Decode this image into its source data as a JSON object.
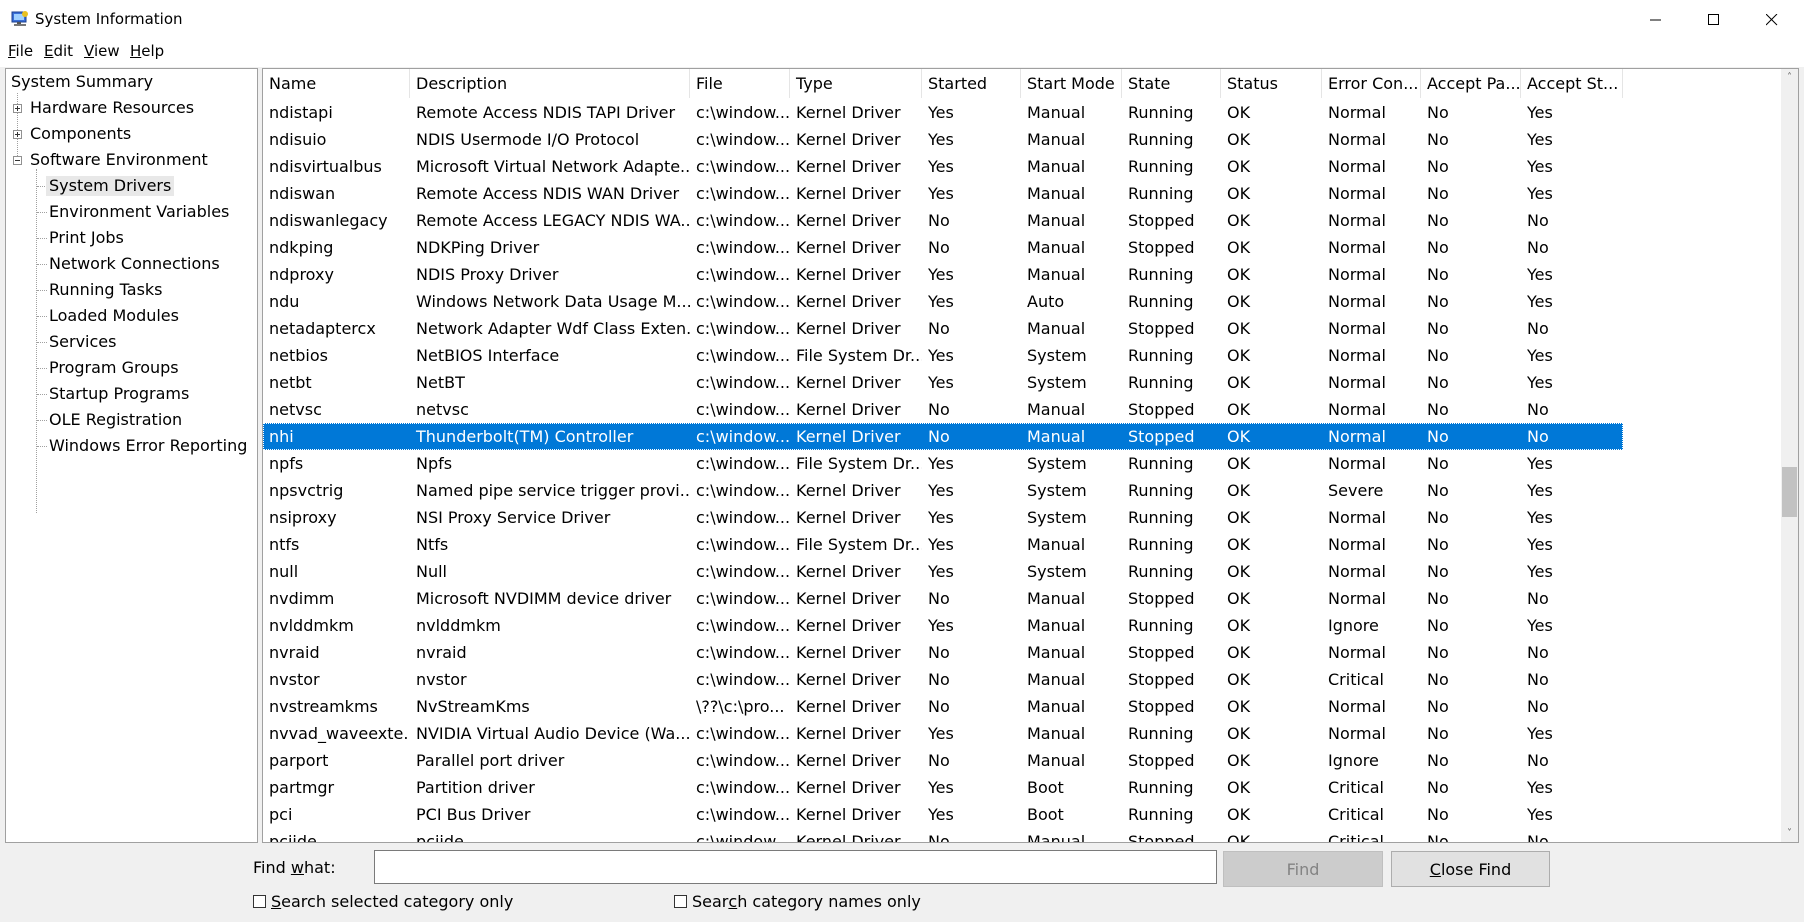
{
  "window": {
    "title": "System Information"
  },
  "menu": {
    "file": {
      "pre": "",
      "key": "F",
      "post": "ile"
    },
    "edit": {
      "pre": "",
      "key": "E",
      "post": "dit"
    },
    "view": {
      "pre": "",
      "key": "V",
      "post": "iew"
    },
    "help": {
      "pre": "",
      "key": "H",
      "post": "elp"
    }
  },
  "tree": {
    "root": "System Summary",
    "hardware": "Hardware Resources",
    "components": "Components",
    "software": "Software Environment",
    "children": [
      "System Drivers",
      "Environment Variables",
      "Print Jobs",
      "Network Connections",
      "Running Tasks",
      "Loaded Modules",
      "Services",
      "Program Groups",
      "Startup Programs",
      "OLE Registration",
      "Windows Error Reporting"
    ]
  },
  "table": {
    "columns": [
      "Name",
      "Description",
      "File",
      "Type",
      "Started",
      "Start Mode",
      "State",
      "Status",
      "Error Con...",
      "Accept Pa...",
      "Accept St..."
    ],
    "rows": [
      [
        "ndistapi",
        "Remote Access NDIS TAPI Driver",
        "c:\\window...",
        "Kernel Driver",
        "Yes",
        "Manual",
        "Running",
        "OK",
        "Normal",
        "No",
        "Yes"
      ],
      [
        "ndisuio",
        "NDIS Usermode I/O Protocol",
        "c:\\window...",
        "Kernel Driver",
        "Yes",
        "Manual",
        "Running",
        "OK",
        "Normal",
        "No",
        "Yes"
      ],
      [
        "ndisvirtualbus",
        "Microsoft Virtual Network Adapte...",
        "c:\\window...",
        "Kernel Driver",
        "Yes",
        "Manual",
        "Running",
        "OK",
        "Normal",
        "No",
        "Yes"
      ],
      [
        "ndiswan",
        "Remote Access NDIS WAN Driver",
        "c:\\window...",
        "Kernel Driver",
        "Yes",
        "Manual",
        "Running",
        "OK",
        "Normal",
        "No",
        "Yes"
      ],
      [
        "ndiswanlegacy",
        "Remote Access LEGACY NDIS WA...",
        "c:\\window...",
        "Kernel Driver",
        "No",
        "Manual",
        "Stopped",
        "OK",
        "Normal",
        "No",
        "No"
      ],
      [
        "ndkping",
        "NDKPing Driver",
        "c:\\window...",
        "Kernel Driver",
        "No",
        "Manual",
        "Stopped",
        "OK",
        "Normal",
        "No",
        "No"
      ],
      [
        "ndproxy",
        "NDIS Proxy Driver",
        "c:\\window...",
        "Kernel Driver",
        "Yes",
        "Manual",
        "Running",
        "OK",
        "Normal",
        "No",
        "Yes"
      ],
      [
        "ndu",
        "Windows Network Data Usage M...",
        "c:\\window...",
        "Kernel Driver",
        "Yes",
        "Auto",
        "Running",
        "OK",
        "Normal",
        "No",
        "Yes"
      ],
      [
        "netadaptercx",
        "Network Adapter Wdf Class Exten...",
        "c:\\window...",
        "Kernel Driver",
        "No",
        "Manual",
        "Stopped",
        "OK",
        "Normal",
        "No",
        "No"
      ],
      [
        "netbios",
        "NetBIOS Interface",
        "c:\\window...",
        "File System Dr...",
        "Yes",
        "System",
        "Running",
        "OK",
        "Normal",
        "No",
        "Yes"
      ],
      [
        "netbt",
        "NetBT",
        "c:\\window...",
        "Kernel Driver",
        "Yes",
        "System",
        "Running",
        "OK",
        "Normal",
        "No",
        "Yes"
      ],
      [
        "netvsc",
        "netvsc",
        "c:\\window...",
        "Kernel Driver",
        "No",
        "Manual",
        "Stopped",
        "OK",
        "Normal",
        "No",
        "No"
      ],
      [
        "nhi",
        "Thunderbolt(TM) Controller",
        "c:\\window...",
        "Kernel Driver",
        "No",
        "Manual",
        "Stopped",
        "OK",
        "Normal",
        "No",
        "No"
      ],
      [
        "npfs",
        "Npfs",
        "c:\\window...",
        "File System Dr...",
        "Yes",
        "System",
        "Running",
        "OK",
        "Normal",
        "No",
        "Yes"
      ],
      [
        "npsvctrig",
        "Named pipe service trigger provi...",
        "c:\\window...",
        "Kernel Driver",
        "Yes",
        "System",
        "Running",
        "OK",
        "Severe",
        "No",
        "Yes"
      ],
      [
        "nsiproxy",
        "NSI Proxy Service Driver",
        "c:\\window...",
        "Kernel Driver",
        "Yes",
        "System",
        "Running",
        "OK",
        "Normal",
        "No",
        "Yes"
      ],
      [
        "ntfs",
        "Ntfs",
        "c:\\window...",
        "File System Dr...",
        "Yes",
        "Manual",
        "Running",
        "OK",
        "Normal",
        "No",
        "Yes"
      ],
      [
        "null",
        "Null",
        "c:\\window...",
        "Kernel Driver",
        "Yes",
        "System",
        "Running",
        "OK",
        "Normal",
        "No",
        "Yes"
      ],
      [
        "nvdimm",
        "Microsoft NVDIMM device driver",
        "c:\\window...",
        "Kernel Driver",
        "No",
        "Manual",
        "Stopped",
        "OK",
        "Normal",
        "No",
        "No"
      ],
      [
        "nvlddmkm",
        "nvlddmkm",
        "c:\\window...",
        "Kernel Driver",
        "Yes",
        "Manual",
        "Running",
        "OK",
        "Ignore",
        "No",
        "Yes"
      ],
      [
        "nvraid",
        "nvraid",
        "c:\\window...",
        "Kernel Driver",
        "No",
        "Manual",
        "Stopped",
        "OK",
        "Normal",
        "No",
        "No"
      ],
      [
        "nvstor",
        "nvstor",
        "c:\\window...",
        "Kernel Driver",
        "No",
        "Manual",
        "Stopped",
        "OK",
        "Critical",
        "No",
        "No"
      ],
      [
        "nvstreamkms",
        "NvStreamKms",
        "\\??\\c:\\pro...",
        "Kernel Driver",
        "No",
        "Manual",
        "Stopped",
        "OK",
        "Normal",
        "No",
        "No"
      ],
      [
        "nvvad_waveexte...",
        "NVIDIA Virtual Audio Device (Wa...",
        "c:\\window...",
        "Kernel Driver",
        "Yes",
        "Manual",
        "Running",
        "OK",
        "Normal",
        "No",
        "Yes"
      ],
      [
        "parport",
        "Parallel port driver",
        "c:\\window...",
        "Kernel Driver",
        "No",
        "Manual",
        "Stopped",
        "OK",
        "Ignore",
        "No",
        "No"
      ],
      [
        "partmgr",
        "Partition driver",
        "c:\\window...",
        "Kernel Driver",
        "Yes",
        "Boot",
        "Running",
        "OK",
        "Critical",
        "No",
        "Yes"
      ],
      [
        "pci",
        "PCI Bus Driver",
        "c:\\window...",
        "Kernel Driver",
        "Yes",
        "Boot",
        "Running",
        "OK",
        "Critical",
        "No",
        "Yes"
      ],
      [
        "pciide",
        "pciide",
        "c:\\window...",
        "Kernel Driver",
        "No",
        "Manual",
        "Stopped",
        "OK",
        "Critical",
        "No",
        "No"
      ]
    ],
    "selected_row": 12
  },
  "find": {
    "label_pre": "Find ",
    "label_key": "w",
    "label_post": "hat:",
    "value": "",
    "find_button": "Find",
    "close_pre": "",
    "close_key": "C",
    "close_post": "lose Find",
    "search_selected_pre": "",
    "search_selected_key": "S",
    "search_selected_post": "earch selected category only",
    "search_names_pre": "Sear",
    "search_names_key": "c",
    "search_names_post": "h category names only"
  }
}
